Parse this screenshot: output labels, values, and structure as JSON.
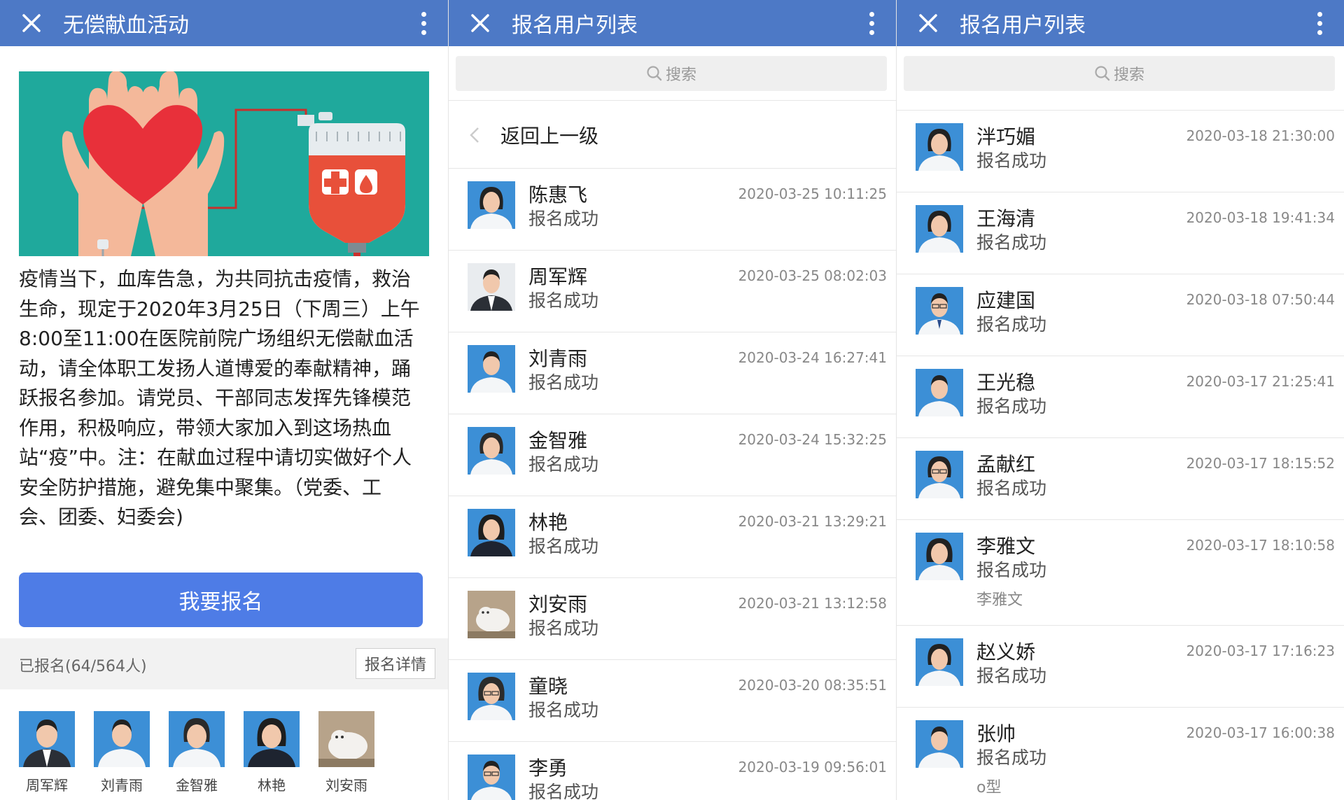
{
  "colors": {
    "topbar": "#4d79c6",
    "button": "#4e7ce6",
    "banner": "#1fa99c"
  },
  "panel1": {
    "title": "无偿献血活动",
    "description": "疫情当下，血库告急，为共同抗击疫情，救治\n生命，现定于2020年3月25日（下周三）上午\n8:00至11:00在医院前院广场组织无偿献血活\n动，请全体职工发扬人道博爱的奉献精神，踊\n跃报名参加。请党员、干部同志发挥先锋模范\n作用，积极响应，带领大家加入到这场热血\n站“疫”中。注：在献血过程中请切实做好个人\n安全防护措施，避免集中聚集。（党委、工\n会、团委、妇委会)",
    "signup_button": "我要报名",
    "signed_count": "已报名(64/564人)",
    "detail_button": "报名详情",
    "avatars": [
      "周军辉",
      "刘青雨",
      "金智雅",
      "林艳",
      "刘安雨"
    ]
  },
  "panel2": {
    "title": "报名用户列表",
    "search_placeholder": "搜索",
    "back_label": "返回上一级",
    "items": [
      {
        "name": "陈惠飞",
        "status": "报名成功",
        "time": "2020-03-25 10:11:25"
      },
      {
        "name": "周军辉",
        "status": "报名成功",
        "time": "2020-03-25 08:02:03"
      },
      {
        "name": "刘青雨",
        "status": "报名成功",
        "time": "2020-03-24 16:27:41"
      },
      {
        "name": "金智雅",
        "status": "报名成功",
        "time": "2020-03-24 15:32:25"
      },
      {
        "name": "林艳",
        "status": "报名成功",
        "time": "2020-03-21 13:29:21"
      },
      {
        "name": "刘安雨",
        "status": "报名成功",
        "time": "2020-03-21 13:12:58"
      },
      {
        "name": "童晓",
        "status": "报名成功",
        "time": "2020-03-20 08:35:51"
      },
      {
        "name": "李勇",
        "status": "报名成功",
        "time": "2020-03-19 09:56:01"
      }
    ]
  },
  "panel3": {
    "title": "报名用户列表",
    "search_placeholder": "搜索",
    "items": [
      {
        "name": "泮巧媚",
        "status": "报名成功",
        "time": "2020-03-18 21:30:00"
      },
      {
        "name": "王海清",
        "status": "报名成功",
        "time": "2020-03-18 19:41:34"
      },
      {
        "name": "应建国",
        "status": "报名成功",
        "time": "2020-03-18 07:50:44"
      },
      {
        "name": "王光稳",
        "status": "报名成功",
        "time": "2020-03-17 21:25:41"
      },
      {
        "name": "孟献红",
        "status": "报名成功",
        "time": "2020-03-17 18:15:52"
      },
      {
        "name": "李雅文",
        "status": "报名成功",
        "time": "2020-03-17 18:10:58",
        "note": "李雅文"
      },
      {
        "name": "赵义娇",
        "status": "报名成功",
        "time": "2020-03-17 17:16:23"
      },
      {
        "name": "张帅",
        "status": "报名成功",
        "time": "2020-03-17 16:00:38",
        "note": "o型"
      }
    ]
  }
}
